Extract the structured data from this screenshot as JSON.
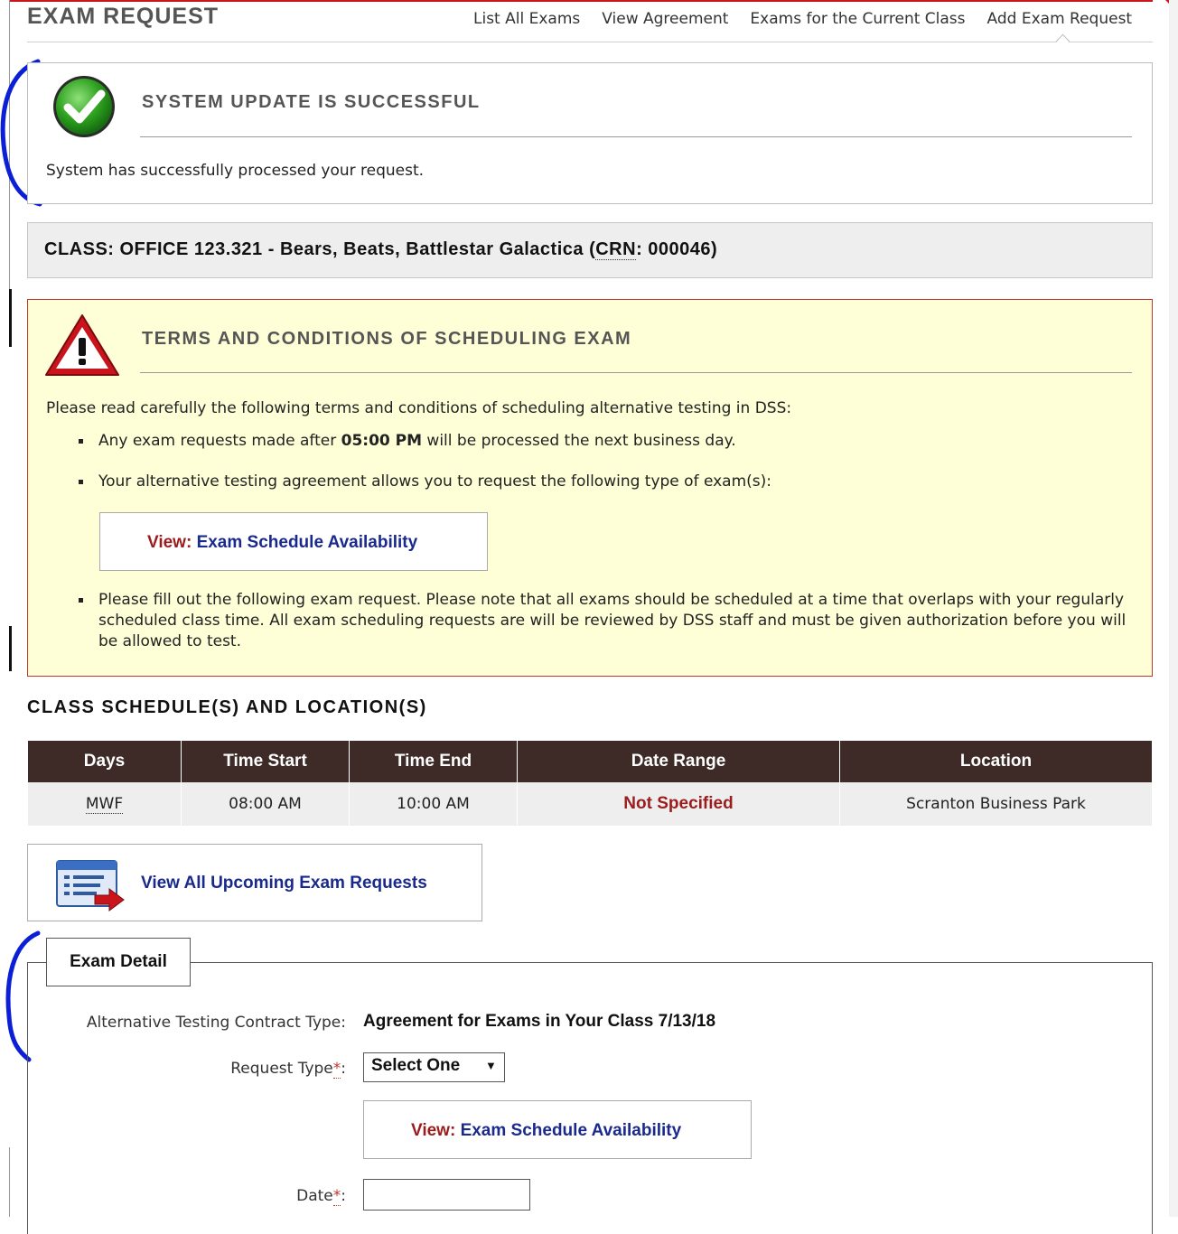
{
  "header": {
    "title": "EXAM REQUEST",
    "nav": [
      "List All Exams",
      "View Agreement",
      "Exams for the Current Class",
      "Add Exam Request"
    ]
  },
  "success": {
    "title": "SYSTEM UPDATE IS SUCCESSFUL",
    "message": "System has successfully processed your request."
  },
  "class_banner": {
    "prefix": "CLASS: OFFICE 123.321 - Bears, Beats, Battlestar Galactica (",
    "abbr": "CRN",
    "suffix": ": 000046)"
  },
  "terms": {
    "title": "TERMS AND CONDITIONS OF SCHEDULING EXAM",
    "intro": "Please read carefully the following terms and conditions of scheduling alternative testing in DSS:",
    "item1_before": "Any exam requests made after ",
    "item1_time": "05:00 PM",
    "item1_after": " will be processed the next business day.",
    "item2": "Your alternative testing agreement allows you to request the following type of exam(s):",
    "item3": "Please fill out the following exam request. Please note that all exams should be scheduled at a time that overlaps with your regularly scheduled class time. All exam scheduling requests are will be reviewed by DSS staff and must be given authorization before you will be allowed to test.",
    "view_prefix": "View:",
    "view_link": "Exam Schedule Availability"
  },
  "schedule": {
    "heading": "CLASS SCHEDULE(S) AND LOCATION(S)",
    "columns": [
      "Days",
      "Time Start",
      "Time End",
      "Date Range",
      "Location"
    ],
    "row": {
      "days": "MWF",
      "time_start": "08:00 AM",
      "time_end": "10:00 AM",
      "date_range": "Not Specified",
      "location": "Scranton Business Park"
    }
  },
  "upcoming": {
    "label": "View All Upcoming Exam Requests"
  },
  "exam_detail": {
    "legend": "Exam Detail",
    "contract_label": "Alternative Testing Contract Type:",
    "contract_value": "Agreement for Exams in Your Class 7/13/18",
    "request_label": "Request Type",
    "request_value": "Select One",
    "date_label": "Date",
    "required_mark": "*",
    "view_prefix": "View:",
    "view_link": "Exam Schedule Availability"
  },
  "colors": {
    "accent_red": "#c0392b",
    "link_blue": "#1a2a8c",
    "table_header": "#3e2b27",
    "terms_bg": "#fefed7"
  },
  "icons": [
    "checkmark-success-icon",
    "warning-triangle-icon",
    "list-arrow-icon",
    "dropdown-arrow-icon"
  ]
}
